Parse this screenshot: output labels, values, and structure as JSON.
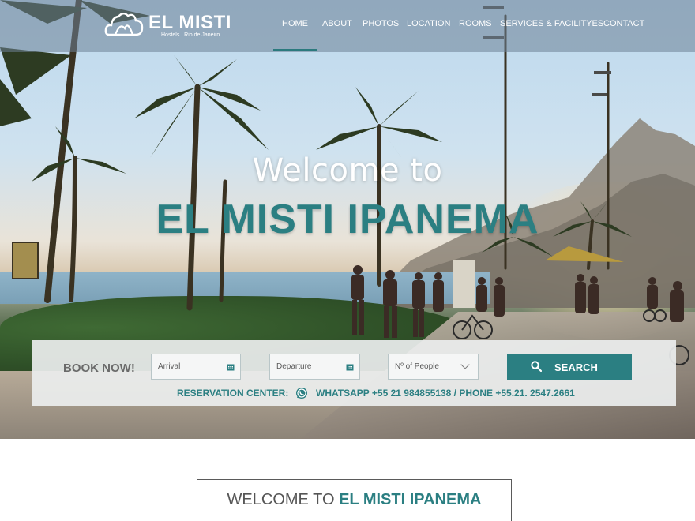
{
  "brand": {
    "name": "EL MISTI",
    "tagline": "Hostels . Rio de Janeiro"
  },
  "nav": {
    "items": [
      "HOME",
      "ABOUT",
      "PHOTOS",
      "LOCATION",
      "ROOMS",
      "SERVICES & FACILITYES",
      "CONTACT"
    ],
    "active": "HOME"
  },
  "hero": {
    "welcome": "Welcome to",
    "title": "EL MISTI IPANEMA"
  },
  "booking": {
    "label": "BOOK NOW!",
    "arrival_placeholder": "Arrival",
    "departure_placeholder": "Departure",
    "people_placeholder": "Nº of People",
    "search_label": "SEARCH",
    "reservation_label": "RESERVATION CENTER:",
    "reservation_contacts": "WHATSAPP +55 21 984855138 / PHONE +55.21. 2547.2661"
  },
  "section": {
    "welcome_prefix": "WELCOME TO ",
    "welcome_name": "EL MISTI IPANEMA"
  },
  "colors": {
    "accent": "#2b7f82",
    "nav_bg": "rgba(110,130,150,0.55)",
    "booking_bg": "#eceeee"
  }
}
